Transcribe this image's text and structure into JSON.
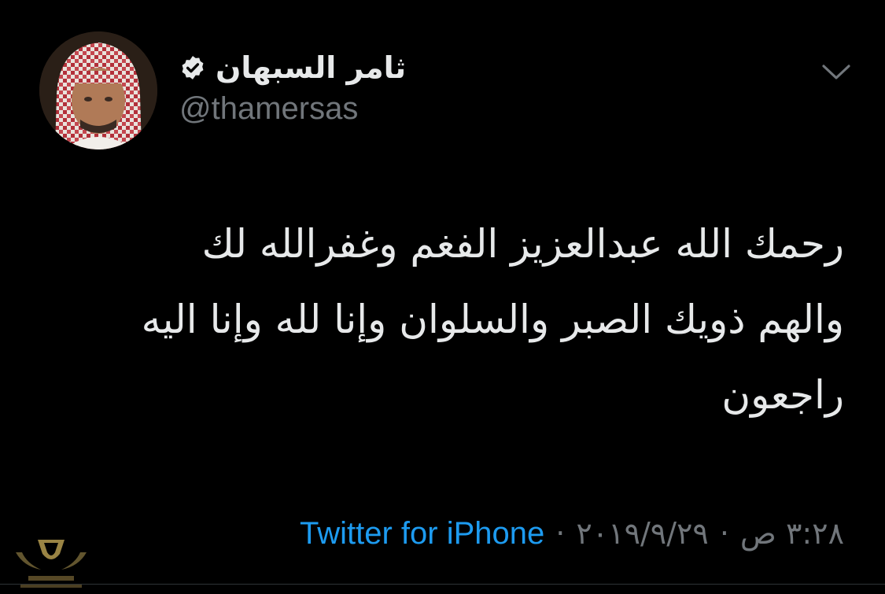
{
  "author": {
    "display_name": "ثامر السبهان",
    "handle": "@thamersas",
    "verified": true
  },
  "tweet": {
    "lines": [
      "رحمك الله عبدالعزيز الفغم وغفرالله لك",
      "والهم ذويك الصبر والسلوان وإنا لله وإنا اليه",
      "راجعون"
    ]
  },
  "meta": {
    "time": "٣:٢٨ ص",
    "date": "٢٠١٩/٩/٢٩",
    "separator": "·",
    "source": "Twitter for iPhone"
  },
  "icons": {
    "verified": "verified-badge-icon",
    "more": "chevron-down-icon"
  },
  "colors": {
    "background": "#000000",
    "text": "#e7e9ea",
    "secondary": "#71767b",
    "link": "#1d9bf0"
  }
}
